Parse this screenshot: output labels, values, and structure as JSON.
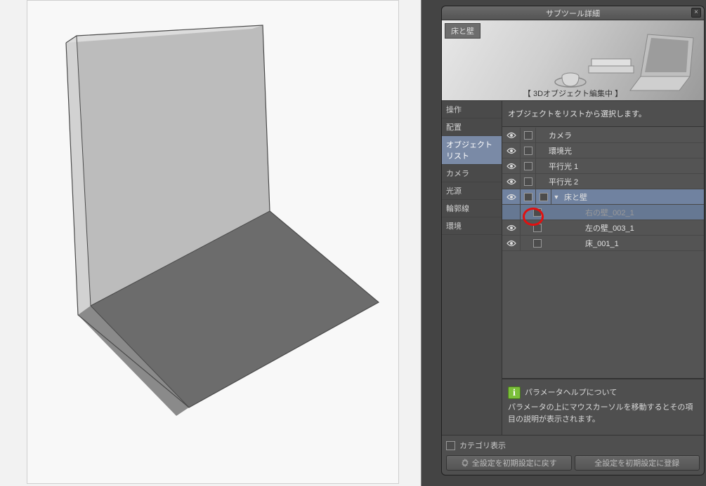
{
  "panel": {
    "title": "サブツール詳細",
    "preview_tag": "床と壁",
    "preview_status": "【 3Dオブジェクト編集中 】",
    "instruction": "オブジェクトをリストから選択します。"
  },
  "side_categories": [
    {
      "label": "操作",
      "selected": false
    },
    {
      "label": "配置",
      "selected": false
    },
    {
      "label": "オブジェクトリスト",
      "selected": true
    },
    {
      "label": "カメラ",
      "selected": false
    },
    {
      "label": "光源",
      "selected": false
    },
    {
      "label": "輪郭線",
      "selected": false
    },
    {
      "label": "環境",
      "selected": false
    }
  ],
  "object_list": [
    {
      "name": "カメラ",
      "visible": true,
      "level": 0,
      "expandable": false
    },
    {
      "name": "環境光",
      "visible": true,
      "level": 0,
      "expandable": false
    },
    {
      "name": "平行光 1",
      "visible": true,
      "level": 0,
      "expandable": false
    },
    {
      "name": "平行光 2",
      "visible": true,
      "level": 0,
      "expandable": false
    },
    {
      "name": "床と壁",
      "visible": true,
      "level": 0,
      "expandable": true,
      "expanded": true,
      "selected": true
    },
    {
      "name": "右の壁_002_1",
      "visible": false,
      "level": 1,
      "dim": true,
      "highlight": true
    },
    {
      "name": "左の壁_003_1",
      "visible": true,
      "level": 1
    },
    {
      "name": "床_001_1",
      "visible": true,
      "level": 1
    }
  ],
  "help": {
    "title": "パラメータヘルプについて",
    "body": "パラメータの上にマウスカーソルを移動するとその項目の説明が表示されます。"
  },
  "footer": {
    "category_show": "カテゴリ表示",
    "reset": "全設定を初期設定に戻す",
    "register": "全設定を初期設定に登録"
  }
}
